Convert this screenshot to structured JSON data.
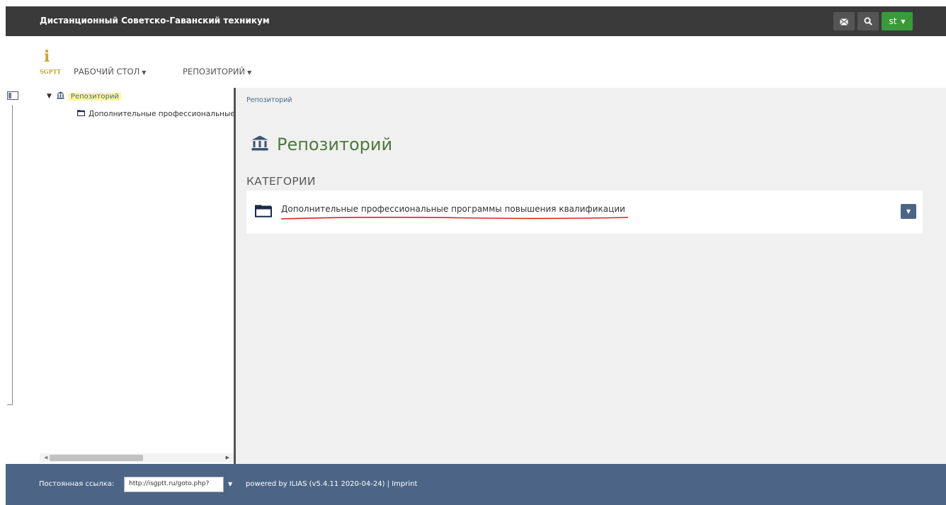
{
  "header": {
    "site_title": "Дистанционный Советско-Гаванский техникум",
    "user_initials": "st"
  },
  "logo": {
    "letter": "i",
    "text": "SGPTT"
  },
  "nav": {
    "desktop": "РАБОЧИЙ СТОЛ",
    "repository": "РЕПОЗИТОРИЙ"
  },
  "tree": {
    "root": "Репозиторий",
    "child": "Дополнительные профессиональные программы повышения квалификации"
  },
  "content": {
    "breadcrumb": "Репозиторий",
    "title": "Репозиторий",
    "section_title": "КАТЕГОРИИ",
    "category_item": "Дополнительные профессиональные программы повышения квалификации"
  },
  "footer": {
    "permalink_label": "Постоянная ссылка:",
    "permalink_value": "http://isgptt.ru/goto.php?",
    "powered_by": "powered by ILIAS (v5.4.11 2020-04-24) | Imprint"
  },
  "colors": {
    "topbar": "#3a3a3a",
    "user_button": "#3a9a3a",
    "footer": "#4c6586",
    "title_green": "#4c7a3c",
    "highlight": "#fff59a",
    "underline_red": "#e02020"
  }
}
